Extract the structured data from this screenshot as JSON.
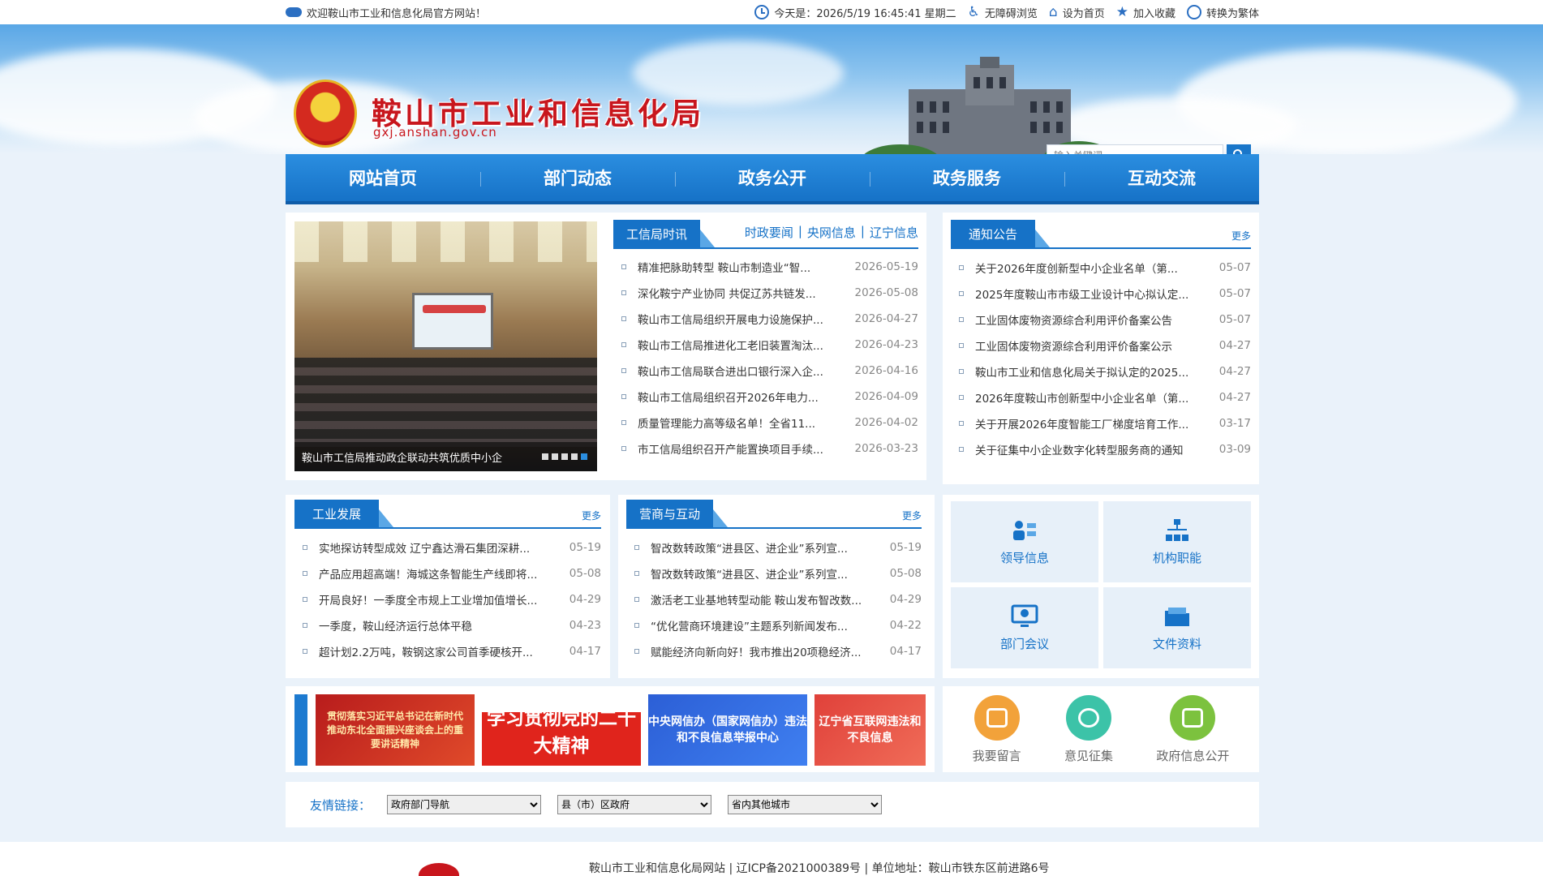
{
  "topbar": {
    "welcome": "欢迎鞍山市工业和信息化局官方网站！",
    "datetime": "今天是：2026/5/19 16:45:41 星期二",
    "tools": [
      "无障碍浏览",
      "设为首页",
      "加入收藏",
      "转换为繁体"
    ]
  },
  "header": {
    "title": "鞍山市工业和信息化局",
    "url": "gxj.anshan.gov.cn",
    "search_placeholder": "输入关键词"
  },
  "nav": [
    "网站首页",
    "部门动态",
    "政务公开",
    "政务服务",
    "互动交流"
  ],
  "slideshow": {
    "caption": "鞍山市工信局推动政企联动共筑优质中小企",
    "dots": 5,
    "active_dot": 5
  },
  "news": {
    "tab": "工信局时讯",
    "links": [
      "时政要闻",
      "央网信息",
      "辽宁信息"
    ],
    "items": [
      {
        "title": "精准把脉助转型 鞍山市制造业“智...",
        "date": "2026-05-19"
      },
      {
        "title": "深化鞍宁产业协同 共促辽苏共链发...",
        "date": "2026-05-08"
      },
      {
        "title": "鞍山市工信局组织开展电力设施保护...",
        "date": "2026-04-27"
      },
      {
        "title": "鞍山市工信局推进化工老旧装置淘汰...",
        "date": "2026-04-23"
      },
      {
        "title": "鞍山市工信局联合进出口银行深入企...",
        "date": "2026-04-16"
      },
      {
        "title": "鞍山市工信局组织召开2026年电力...",
        "date": "2026-04-09"
      },
      {
        "title": "质量管理能力高等级名单！全省11...",
        "date": "2026-04-02"
      },
      {
        "title": "市工信局组织召开产能置换项目手续...",
        "date": "2026-03-23"
      }
    ]
  },
  "notices": {
    "tab": "通知公告",
    "more": "更多",
    "items": [
      {
        "title": "关于2026年度创新型中小企业名单（第...",
        "date": "05-07"
      },
      {
        "title": "2025年度鞍山市市级工业设计中心拟认定...",
        "date": "05-07"
      },
      {
        "title": "工业固体废物资源综合利用评价备案公告",
        "date": "05-07"
      },
      {
        "title": "工业固体废物资源综合利用评价备案公示",
        "date": "04-27"
      },
      {
        "title": "鞍山市工业和信息化局关于拟认定的2025...",
        "date": "04-27"
      },
      {
        "title": "2026年度鞍山市创新型中小企业名单（第...",
        "date": "04-27"
      },
      {
        "title": "关于开展2026年度智能工厂梯度培育工作...",
        "date": "03-17"
      },
      {
        "title": "关于征集中小企业数字化转型服务商的通知",
        "date": "03-09"
      }
    ]
  },
  "industry": {
    "tab": "工业发展",
    "more": "更多",
    "items": [
      {
        "title": "实地探访转型成效 辽宁鑫达滑石集团深耕...",
        "date": "05-19"
      },
      {
        "title": "产品应用超高端！海城这条智能生产线即将...",
        "date": "05-08"
      },
      {
        "title": "开局良好！一季度全市规上工业增加值增长...",
        "date": "04-29"
      },
      {
        "title": "一季度，鞍山经济运行总体平稳",
        "date": "04-23"
      },
      {
        "title": "超计划2.2万吨，鞍钢这家公司首季硬核开...",
        "date": "04-17"
      }
    ]
  },
  "business": {
    "tab": "营商与互动",
    "more": "更多",
    "items": [
      {
        "title": "智改数转政策“进县区、进企业”系列宣...",
        "date": "05-19"
      },
      {
        "title": "智改数转政策“进县区、进企业”系列宣...",
        "date": "05-08"
      },
      {
        "title": "激活老工业基地转型动能 鞍山发布智改数...",
        "date": "04-29"
      },
      {
        "title": "“优化营商环境建设”主题系列新闻发布...",
        "date": "04-22"
      },
      {
        "title": "赋能经济向新向好！我市推出20项稳经济...",
        "date": "04-17"
      }
    ]
  },
  "quick": [
    {
      "label": "领导信息",
      "icon": "leader-icon"
    },
    {
      "label": "机构职能",
      "icon": "org-chart-icon"
    },
    {
      "label": "部门会议",
      "icon": "meeting-icon"
    },
    {
      "label": "文件资料",
      "icon": "folder-icon"
    }
  ],
  "ads": {
    "ad1": "贯彻落实习近平总书记在新时代推动东北全面振兴座谈会上的重要讲话精神",
    "ad2": "学习贯彻党的二十大精神",
    "ad3": "中央网信办（国家网信办）违法和不良信息举报中心",
    "ad4": "辽宁省互联网违法和不良信息"
  },
  "services": [
    {
      "label": "我要留言",
      "color": "#f2a23a",
      "icon": "edit-icon"
    },
    {
      "label": "意见征集",
      "color": "#3cc3a8",
      "icon": "message-icon"
    },
    {
      "label": "政府信息公开",
      "color": "#7cc23e",
      "icon": "chat-icon"
    }
  ],
  "friend_links": {
    "label": "友情链接：",
    "selects": [
      "政府部门导航",
      "县（市）区政府",
      "省内其他城市"
    ]
  },
  "footer": {
    "text": "鞍山市工业和信息化局网站 | 辽ICP备2021000389号 | 单位地址：鞍山市铁东区前进路6号"
  }
}
